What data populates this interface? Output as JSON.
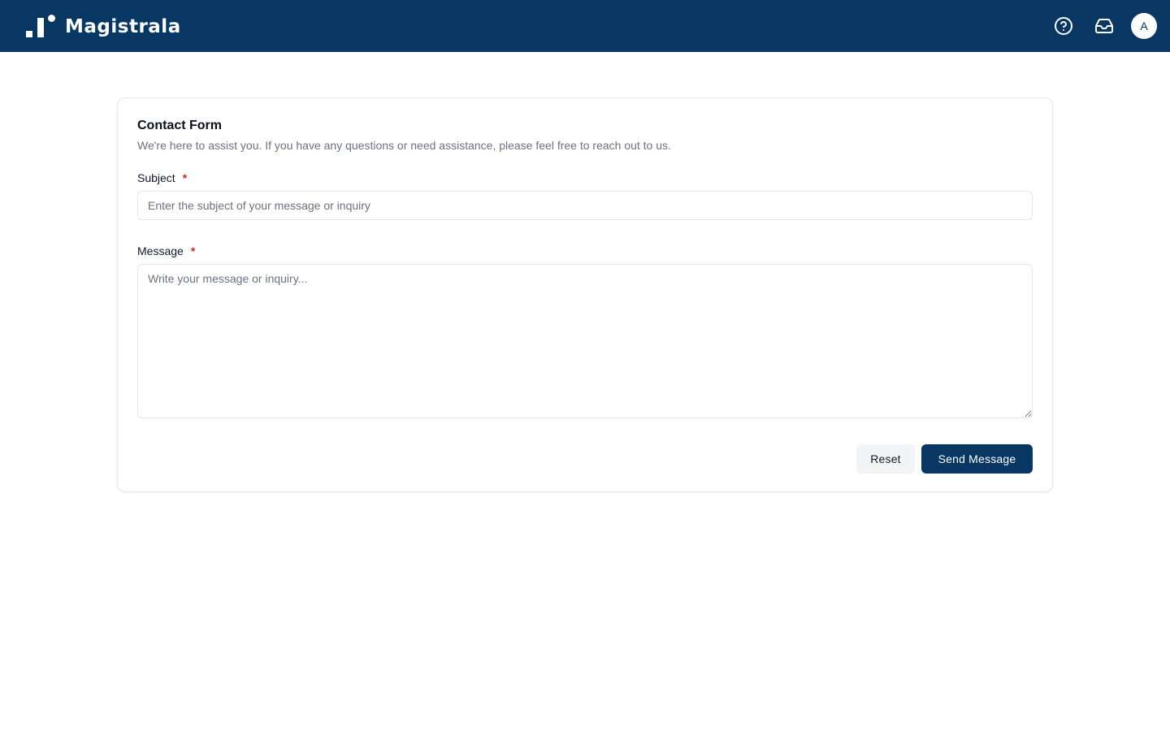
{
  "app": {
    "name": "Magistrala"
  },
  "header": {
    "help_icon": "help-circle-icon",
    "inbox_icon": "inbox-icon",
    "avatar_initial": "A"
  },
  "form": {
    "title": "Contact Form",
    "description": "We're here to assist you. If you have any questions or need assistance, please feel free to reach out to us.",
    "subject": {
      "label": "Subject",
      "required_mark": "*",
      "value": "",
      "placeholder": "Enter the subject of your message or inquiry"
    },
    "message": {
      "label": "Message",
      "required_mark": "*",
      "value": "",
      "placeholder": "Write your message or inquiry..."
    },
    "reset_label": "Reset",
    "send_label": "Send Message"
  },
  "colors": {
    "brand": "#083764",
    "required": "#dc2626",
    "page_background": "#ffffff"
  }
}
